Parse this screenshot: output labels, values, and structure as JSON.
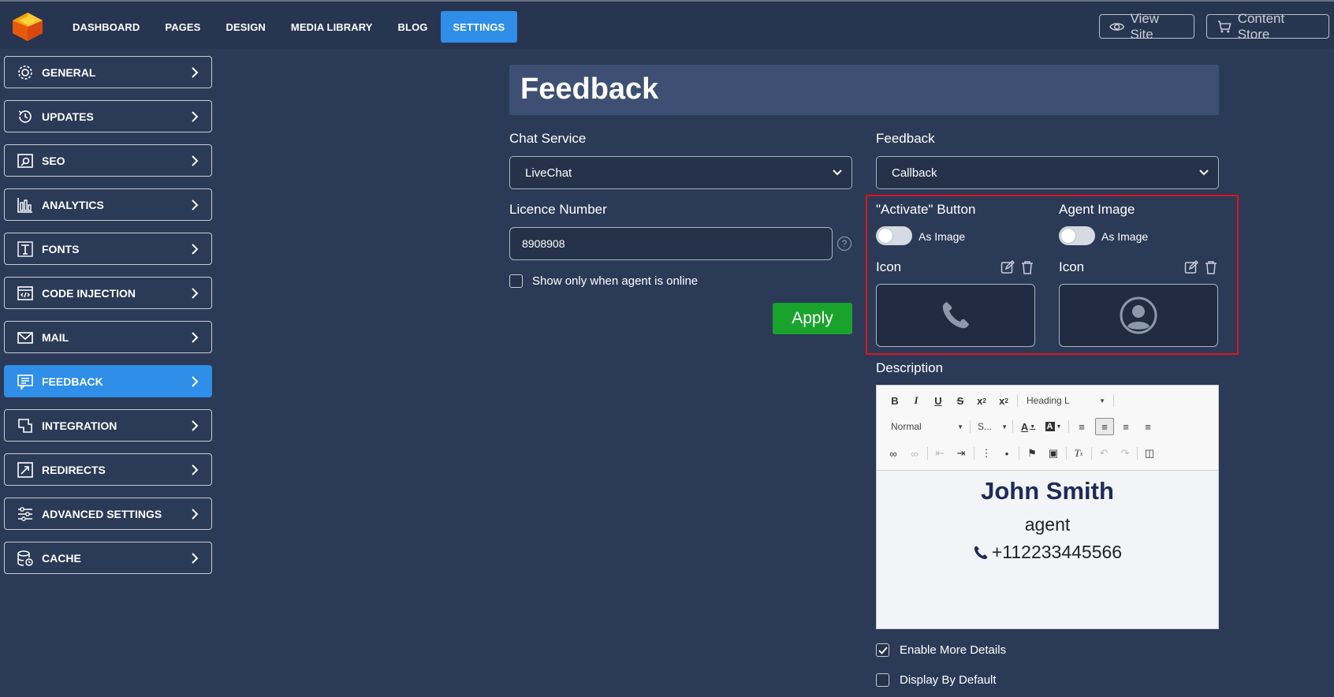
{
  "topbar": {
    "nav": [
      "DASHBOARD",
      "PAGES",
      "DESIGN",
      "MEDIA LIBRARY",
      "BLOG",
      "SETTINGS"
    ],
    "active": "SETTINGS",
    "view_site": "View Site",
    "content_store": "Content Store"
  },
  "sidebar": {
    "items": [
      {
        "label": "GENERAL",
        "icon": "gear-icon"
      },
      {
        "label": "UPDATES",
        "icon": "history-icon"
      },
      {
        "label": "SEO",
        "icon": "seo-icon"
      },
      {
        "label": "ANALYTICS",
        "icon": "bar-chart-icon"
      },
      {
        "label": "FONTS",
        "icon": "font-icon"
      },
      {
        "label": "CODE INJECTION",
        "icon": "code-icon"
      },
      {
        "label": "MAIL",
        "icon": "mail-icon"
      },
      {
        "label": "FEEDBACK",
        "icon": "feedback-icon"
      },
      {
        "label": "INTEGRATION",
        "icon": "integration-icon"
      },
      {
        "label": "REDIRECTS",
        "icon": "redirect-icon"
      },
      {
        "label": "ADVANCED SETTINGS",
        "icon": "sliders-icon"
      },
      {
        "label": "CACHE",
        "icon": "cache-icon"
      }
    ],
    "active_index": 7
  },
  "main": {
    "title": "Feedback",
    "chat_service": {
      "label": "Chat Service",
      "value": "LiveChat"
    },
    "licence": {
      "label": "Licence Number",
      "value": "8908908",
      "help": "?"
    },
    "online_only": {
      "label": "Show only when agent is online",
      "checked": false
    },
    "apply": "Apply",
    "feedback": {
      "label": "Feedback",
      "value": "Callback"
    },
    "activate_button": {
      "label": "\"Activate\" Button",
      "toggle_label": "As Image",
      "icon_label": "Icon"
    },
    "agent_image": {
      "label": "Agent Image",
      "toggle_label": "As Image",
      "icon_label": "Icon"
    },
    "description": {
      "label": "Description",
      "heading_dropdown": "Heading L",
      "format_dropdown": "Normal",
      "size_dropdown": "S...",
      "content": {
        "name": "John Smith",
        "role": "agent",
        "phone": "+112233445566"
      }
    },
    "enable_more_details": {
      "label": "Enable More Details",
      "checked": true
    },
    "display_by_default": {
      "label": "Display By Default",
      "checked": false
    }
  }
}
